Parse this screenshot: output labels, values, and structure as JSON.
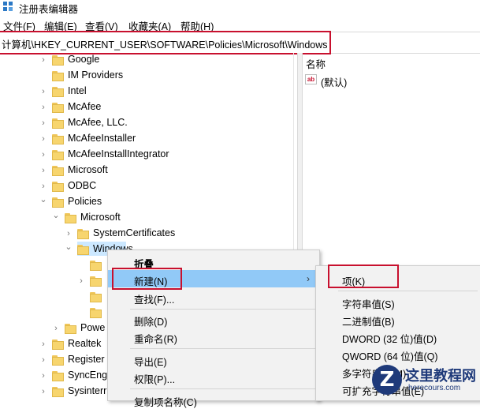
{
  "window": {
    "title": "注册表编辑器"
  },
  "menubar": {
    "items": [
      "文件(F)",
      "编辑(E)",
      "查看(V)",
      "收藏夹(A)",
      "帮助(H)"
    ]
  },
  "address": {
    "path": "计算机\\HKEY_CURRENT_USER\\SOFTWARE\\Policies\\Microsoft\\Windows"
  },
  "tree": {
    "items": [
      {
        "label": "Google",
        "expand": "collapsed"
      },
      {
        "label": "IM Providers",
        "expand": "none"
      },
      {
        "label": "Intel",
        "expand": "collapsed"
      },
      {
        "label": "McAfee",
        "expand": "collapsed"
      },
      {
        "label": "McAfee, LLC.",
        "expand": "collapsed"
      },
      {
        "label": "McAfeeInstaller",
        "expand": "collapsed"
      },
      {
        "label": "McAfeeInstallIntegrator",
        "expand": "collapsed"
      },
      {
        "label": "Microsoft",
        "expand": "collapsed"
      },
      {
        "label": "ODBC",
        "expand": "collapsed"
      },
      {
        "label": "Policies",
        "expand": "expanded"
      },
      {
        "label": "Microsoft",
        "expand": "expanded"
      },
      {
        "label": "SystemCertificates",
        "expand": "collapsed"
      },
      {
        "label": "Windows",
        "expand": "expanded",
        "selected": true
      },
      {
        "label": "",
        "expand": "none"
      },
      {
        "label": "",
        "expand": "collapsed"
      },
      {
        "label": "",
        "expand": "none"
      },
      {
        "label": "",
        "expand": "none"
      },
      {
        "label": "Powe",
        "expand": "collapsed"
      },
      {
        "label": "Realtek",
        "expand": "collapsed"
      },
      {
        "label": "Register",
        "expand": "collapsed"
      },
      {
        "label": "SyncEng",
        "expand": "collapsed"
      },
      {
        "label": "Sysinterr",
        "expand": "collapsed"
      }
    ]
  },
  "right_pane": {
    "column_name": "名称",
    "values": [
      {
        "name": "(默认)",
        "icon": "string-value-icon"
      }
    ]
  },
  "context_menu": {
    "items": [
      "折叠",
      "新建(N)",
      "查找(F)...",
      "删除(D)",
      "重命名(R)",
      "导出(E)",
      "权限(P)...",
      "复制项名称(C)"
    ],
    "highlighted": "新建(N)"
  },
  "submenu": {
    "items": [
      "项(K)",
      "字符串值(S)",
      "二进制值(B)",
      "DWORD (32 位)值(D)",
      "QWORD (64 位)值(Q)",
      "多字符串值(M)",
      "可扩充字符串值(E)"
    ]
  },
  "watermark": {
    "mark": "Z",
    "title": "这里教程网",
    "url": "herecours.com"
  },
  "colors": {
    "accent": "#c8102e",
    "highlight": "#91c9f7",
    "selected": "#cce8ff",
    "folder": "#f7d56e"
  }
}
